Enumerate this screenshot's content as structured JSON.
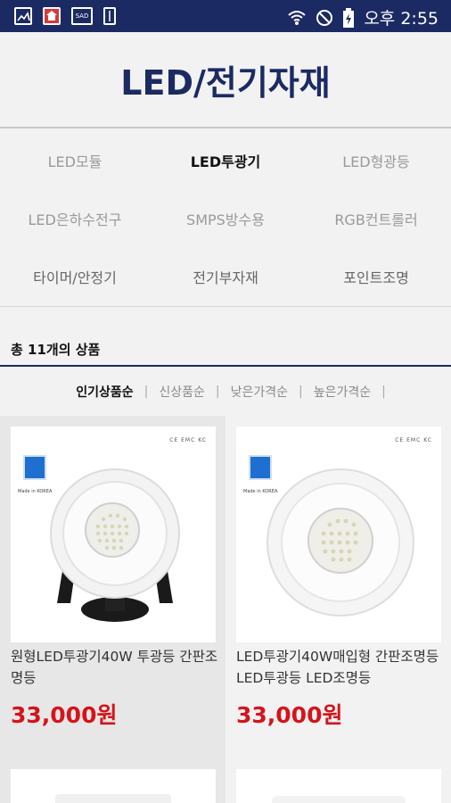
{
  "status_bar": {
    "time": "오후 2:55",
    "left_icons": [
      "gallery-icon",
      "store-icon",
      "sd-card-icon",
      "usb-icon"
    ],
    "right_icons": [
      "wifi-icon",
      "no-sim-icon",
      "battery-charging-icon"
    ]
  },
  "header": {
    "title": "LED/전기자재"
  },
  "categories": [
    {
      "label": "LED모듈",
      "active": false
    },
    {
      "label": "LED투광기",
      "active": true
    },
    {
      "label": "LED형광등",
      "active": false
    },
    {
      "label": "LED은하수전구",
      "active": false
    },
    {
      "label": "SMPS방수용",
      "active": false
    },
    {
      "label": "RGB컨트롤러",
      "active": false
    },
    {
      "label": "타이머/안정기",
      "active": false
    },
    {
      "label": "전기부자재",
      "active": false
    },
    {
      "label": "포인트조명",
      "active": false
    }
  ],
  "count_text": "총 11개의 상품",
  "sort": {
    "options": [
      "인기상품순",
      "신상품순",
      "낮은가격순",
      "높은가격순"
    ],
    "selected": "인기상품순"
  },
  "products": [
    {
      "name": "원형LED투광기40W 투광등 간판조명등",
      "price": "33,000원",
      "image": "round-led-floodlight-with-stand"
    },
    {
      "name": "LED투광기40W매입형 간판조명등 LED투광등 LED조명등",
      "price": "33,000원",
      "image": "recessed-round-led-floodlight"
    }
  ],
  "image_text": {
    "made_in": "Made in KOREA",
    "certs": "CE  EMC  KC"
  },
  "colors": {
    "status_bar": "#1b2a63",
    "title": "#1b2a63",
    "price": "#d4141b",
    "accent_line": "#1b2a63"
  }
}
